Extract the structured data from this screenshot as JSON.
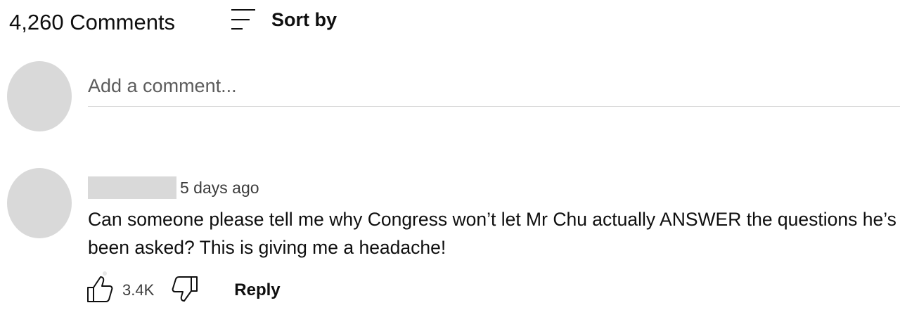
{
  "header": {
    "comments_count_label": "4,260 Comments",
    "sort_label": "Sort by",
    "sort_icon": "sort-icon"
  },
  "add_comment": {
    "placeholder": "Add a comment..."
  },
  "comments": [
    {
      "author": "",
      "timestamp": "5 days ago",
      "text": "Can someone please tell me why Congress won’t let Mr Chu actually ANSWER the questions he’s been asked? This is giving me a headache!",
      "likes": "3.4K",
      "reply_label": "Reply",
      "like_icon": "thumbs-up-icon",
      "dislike_icon": "thumbs-down-icon"
    }
  ]
}
